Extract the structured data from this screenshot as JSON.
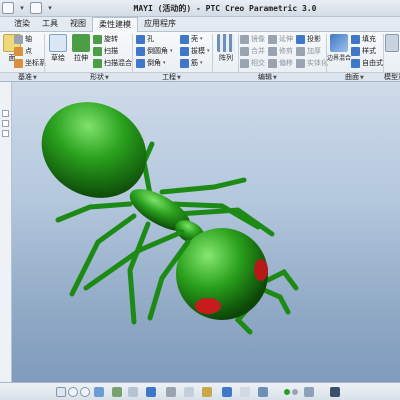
{
  "titlebar": {
    "title": "MAYI (活动的) - PTC Creo Parametric 3.0"
  },
  "menu": {
    "tabs": [
      "文件",
      "渲染",
      "工具",
      "视图",
      "柔性建模",
      "应用程序"
    ]
  },
  "ribbon": {
    "datum": {
      "axis": "轴",
      "point": "点",
      "coord_sys": "坐标系",
      "plane_cut": "面"
    },
    "shapes": {
      "sketch": "草绘",
      "extrude": "拉伸",
      "revolve": "旋转",
      "sweep": "扫描",
      "swept_blend": "扫描混合",
      "hole": "孔",
      "round": "倒圆角",
      "chamfer": "倒角",
      "rib": "筋",
      "draft": "拔模",
      "shell": "壳",
      "pattern": "阵列"
    },
    "edit": {
      "mirror": "镜像",
      "extend": "延伸",
      "project": "投影",
      "merge": "合并",
      "trim": "修剪",
      "offset": "偏移",
      "thicken": "加厚",
      "intersect": "相交",
      "solidify": "实体化"
    },
    "surface": {
      "boundary_blend": "边界混合",
      "fill": "填充",
      "style": "样式",
      "freestyle": "自由式"
    },
    "model_intent": "模型意图"
  },
  "groups": {
    "datum": "基准",
    "shapes": "形状",
    "engineering": "工程",
    "edit": "编辑",
    "surface": "曲面",
    "intent": "模型意"
  },
  "viewport": {
    "model": "ant",
    "body_color": "#2aa11e",
    "eye_color": "#c81c1c",
    "background_top": "#cfdbe9",
    "background_bottom": "#7f9bbd"
  },
  "icons": {
    "status": "green-status-dot",
    "repaint": "repaint-icon",
    "zoom_in": "zoom-in-icon",
    "zoom_out": "zoom-out-icon"
  }
}
